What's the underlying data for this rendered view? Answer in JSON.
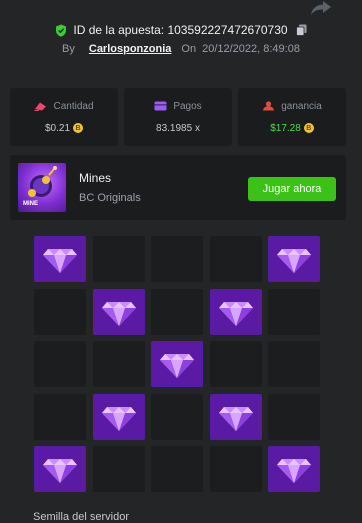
{
  "header": {
    "bet_id_label": "ID de la apuesta: 103592227472670730",
    "by_label": "By",
    "username": "Carlosponzonia",
    "on_label": "On",
    "datetime": "20/12/2022, 8:49:08"
  },
  "stats": [
    {
      "label": "Cantidad",
      "value": "$0.21",
      "icon": "cash-icon"
    },
    {
      "label": "Pagos",
      "value": "83.1985 x",
      "icon": "wallet-icon"
    },
    {
      "label": "ganancia",
      "value": "$17.28",
      "icon": "profit-icon"
    }
  ],
  "game": {
    "title": "Mines",
    "provider": "BC Originals",
    "thumb_label": "MINE",
    "play_label": "Jugar ahora"
  },
  "board": {
    "rows": 5,
    "cols": 5,
    "cells": [
      "gem",
      "empty",
      "empty",
      "empty",
      "gem",
      "empty",
      "gem",
      "empty",
      "gem",
      "empty",
      "empty",
      "empty",
      "gem",
      "empty",
      "empty",
      "empty",
      "gem",
      "empty",
      "gem",
      "empty",
      "gem",
      "empty",
      "empty",
      "empty",
      "gem"
    ]
  },
  "footer": {
    "server_seed_label": "Semilla del servidor"
  },
  "colors": {
    "background": "#232527",
    "panel": "#1a1c1e",
    "accent_green": "#3bc117",
    "profit_green": "#4fdc4a",
    "gem_tile": "#5b1aa3"
  }
}
